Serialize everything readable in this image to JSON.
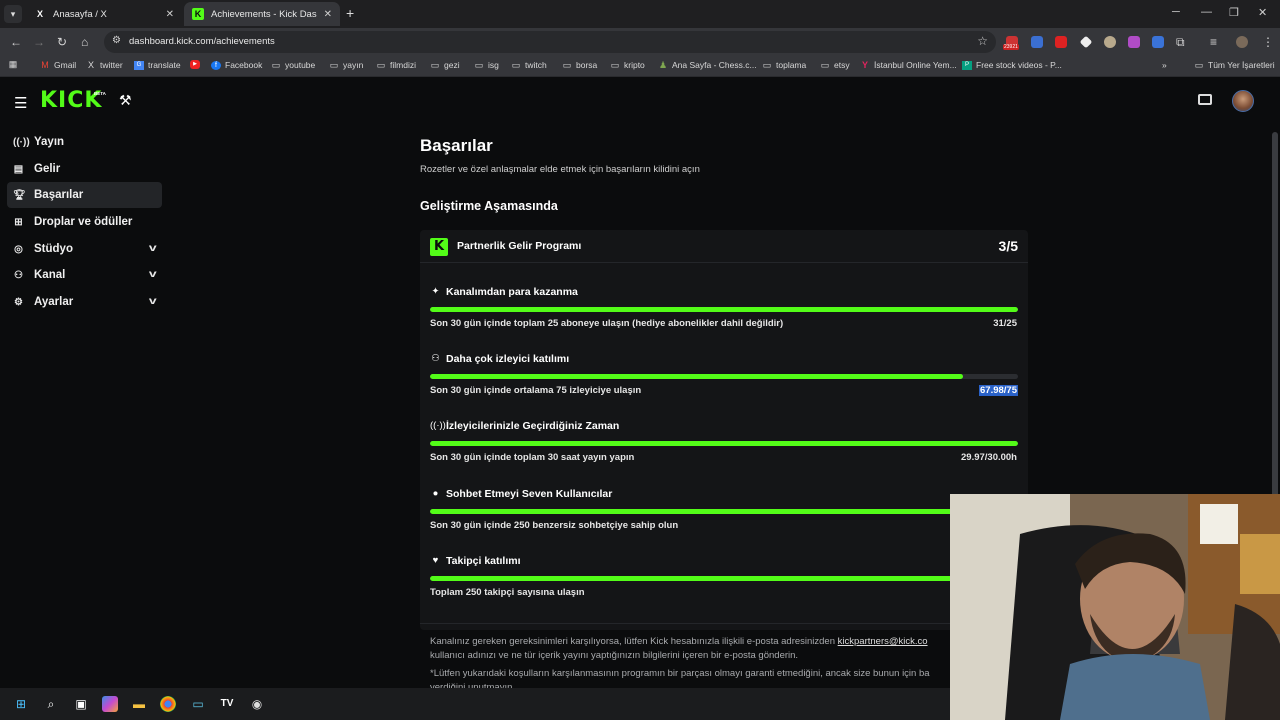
{
  "browser": {
    "tabs": [
      {
        "title": "Anasayfa / X",
        "favicon": "x-logo-icon"
      },
      {
        "title": "Achievements - Kick Dashboard",
        "favicon": "kick-logo-icon"
      }
    ],
    "url": "dashboard.kick.com/achievements",
    "extension_badge": "23921",
    "bookmarks": [
      "Gmail",
      "twitter",
      "translate",
      "",
      "Facebook",
      "youtube",
      "yayın",
      "filmdizi",
      "gezi",
      "isg",
      "twitch",
      "borsa",
      "kripto",
      "Ana Sayfa - Chess.c...",
      "toplama",
      "etsy",
      "İstanbul Online Yem...",
      "Free stock videos - P..."
    ],
    "bookmarks_all": "Tüm Yer İşaretleri"
  },
  "app": {
    "logo": "KICK",
    "beta": "BETA"
  },
  "sidebar": {
    "items": [
      {
        "label": "Yayın",
        "icon": "broadcast-icon",
        "expandable": false
      },
      {
        "label": "Gelir",
        "icon": "revenue-icon",
        "expandable": false
      },
      {
        "label": "Başarılar",
        "icon": "trophy-icon",
        "expandable": false,
        "active": true
      },
      {
        "label": "Droplar ve ödüller",
        "icon": "gift-icon",
        "expandable": false
      },
      {
        "label": "Stüdyo",
        "icon": "studio-icon",
        "expandable": true
      },
      {
        "label": "Kanal",
        "icon": "users-icon",
        "expandable": true
      },
      {
        "label": "Ayarlar",
        "icon": "gear-icon",
        "expandable": true
      }
    ]
  },
  "main": {
    "title": "Başarılar",
    "subtitle": "Rozetler ve özel anlaşmalar elde etmek için başarıların kilidini açın",
    "section_title": "Geliştirme Aşamasında",
    "program": {
      "title": "Partnerlik Gelir Programı",
      "count": "3/5",
      "achievements": [
        {
          "name": "Kanalımdan para kazanma",
          "icon": "sparkle-icon",
          "desc": "Son 30 gün içinde toplam 25 aboneye ulaşın (hediye abonelikler dahil değildir)",
          "value": "31/25",
          "progress": 1.0
        },
        {
          "name": "Daha çok izleyici katılımı",
          "icon": "viewers-icon",
          "desc": "Son 30 gün içinde ortalama 75 izleyiciye ulaşın",
          "value": "67.98/75",
          "progress": 0.906
        },
        {
          "name": "İzleyicilerinizle Geçirdiğiniz Zaman",
          "icon": "live-icon",
          "desc": "Son 30 gün içinde toplam 30 saat yayın yapın",
          "value": "29.97/30.00h",
          "progress": 1.0
        },
        {
          "name": "Sohbet Etmeyi Seven Kullanıcılar",
          "icon": "chat-icon",
          "desc": "Son 30 gün içinde 250 benzersiz sohbetçiye sahip olun",
          "value": "",
          "progress": 1.0
        },
        {
          "name": "Takipçi katılımı",
          "icon": "heart-icon",
          "desc": "Toplam 250 takipçi sayısına ulaşın",
          "value": "",
          "progress": 1.0
        }
      ]
    },
    "note": {
      "line1_prefix": "Kanalınız gereken gereksinimleri karşılıyorsa, lütfen Kick hesabınızla ilişkili e-posta adresinizden ",
      "line1_email": "kickpartners@kick.co",
      "line2": "kullanıcı adınızı ve ne tür içerik yayını yaptığınızın bilgilerini içeren bir e-posta gönderin.",
      "line3": "*Lütfen yukarıdaki koşulların karşılanmasının programın bir parçası olmayı garanti etmediğini, ancak size bunun için ba",
      "line4": "verdiğini unutmayın."
    }
  },
  "colors": {
    "accent": "#53fc18",
    "background": "#0b0c0d",
    "card": "#141517",
    "selection": "#2a62c9"
  }
}
